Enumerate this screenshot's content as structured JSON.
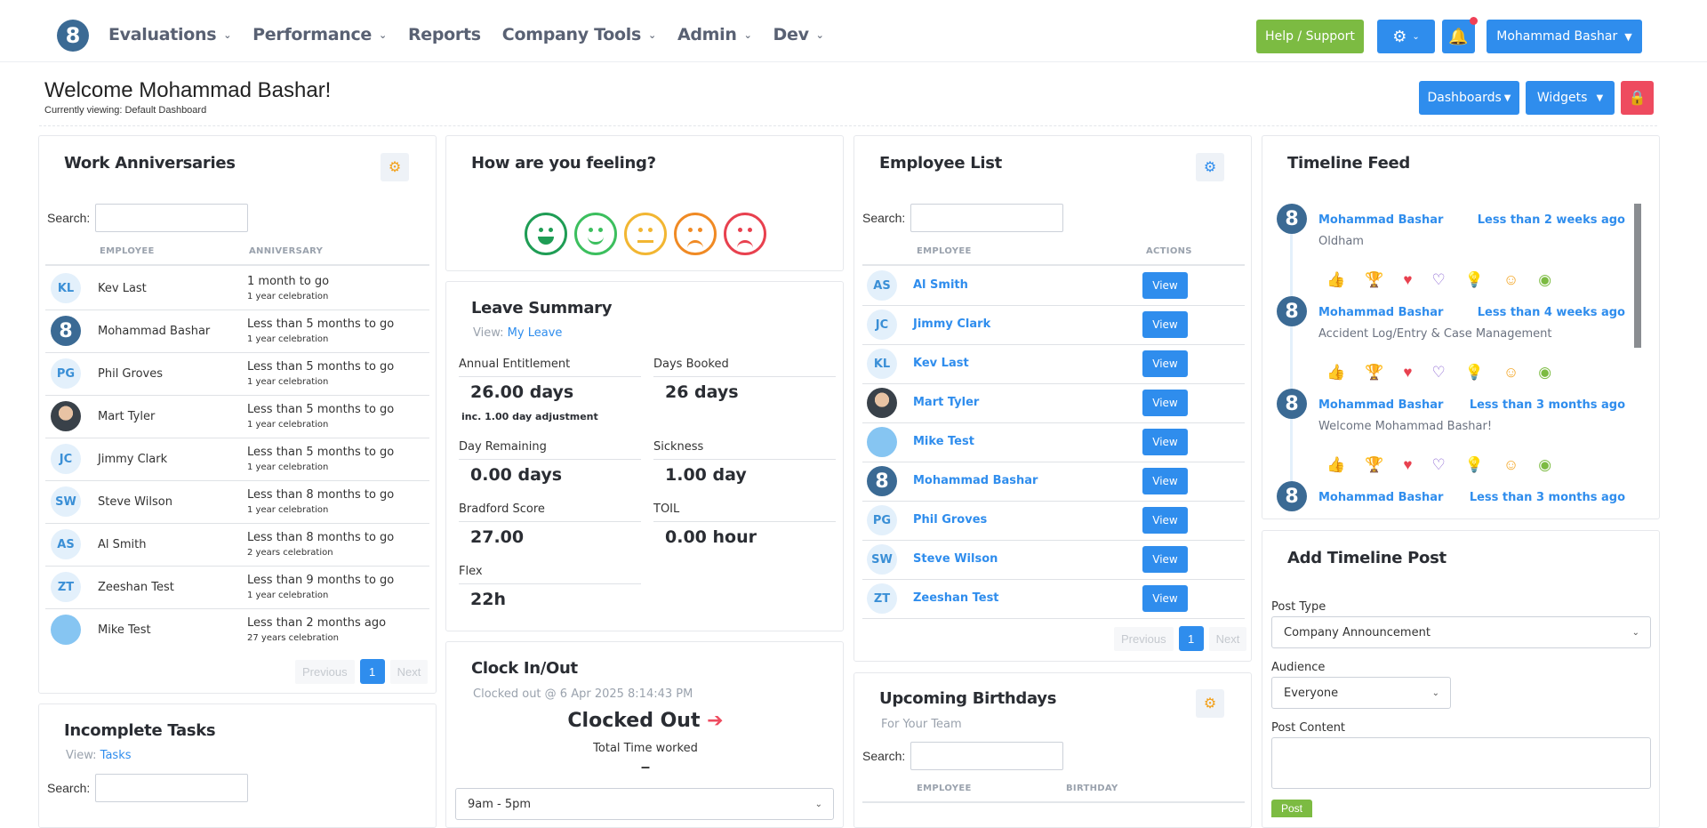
{
  "nav": {
    "logo_text": "8",
    "items": [
      {
        "label": "Evaluations",
        "dropdown": true
      },
      {
        "label": "Performance",
        "dropdown": true
      },
      {
        "label": "Reports",
        "dropdown": false
      },
      {
        "label": "Company Tools",
        "dropdown": true
      },
      {
        "label": "Admin",
        "dropdown": true
      },
      {
        "label": "Dev",
        "dropdown": true
      }
    ],
    "help_label": "Help / Support",
    "user_label": "Mohammad Bashar",
    "colors": {
      "primary": "#2f8ded",
      "help": "#7cbb42",
      "danger": "#ee4b5f",
      "badge": "#ef4056"
    }
  },
  "welcome": {
    "title": "Welcome Mohammad Bashar!",
    "viewing": "Currently viewing: Default Dashboard",
    "dashboards_label": "Dashboards",
    "widgets_label": "Widgets"
  },
  "work_anniversaries": {
    "title": "Work Anniversaries",
    "search_label": "Search:",
    "col_employee": "EMPLOYEE",
    "col_anniversary": "ANNIVERSARY",
    "rows": [
      {
        "initials": "KL",
        "avatar": "initials",
        "name": "Kev Last",
        "anniversary": "1 month to go",
        "celebration": "1 year celebration"
      },
      {
        "initials": "",
        "avatar": "logo",
        "name": "Mohammad Bashar",
        "anniversary": "Less than 5 months to go",
        "celebration": "1 year celebration"
      },
      {
        "initials": "PG",
        "avatar": "initials",
        "name": "Phil Groves",
        "anniversary": "Less than 5 months to go",
        "celebration": "1 year celebration"
      },
      {
        "initials": "",
        "avatar": "photo",
        "name": "Mart Tyler",
        "anniversary": "Less than 5 months to go",
        "celebration": "1 year celebration"
      },
      {
        "initials": "JC",
        "avatar": "initials",
        "name": "Jimmy Clark",
        "anniversary": "Less than 5 months to go",
        "celebration": "1 year celebration"
      },
      {
        "initials": "SW",
        "avatar": "initials",
        "name": "Steve Wilson",
        "anniversary": "Less than 8 months to go",
        "celebration": "1 year celebration"
      },
      {
        "initials": "AS",
        "avatar": "initials",
        "name": "Al Smith",
        "anniversary": "Less than 8 months to go",
        "celebration": "2 years celebration"
      },
      {
        "initials": "ZT",
        "avatar": "initials",
        "name": "Zeeshan Test",
        "anniversary": "Less than 9 months to go",
        "celebration": "1 year celebration"
      },
      {
        "initials": "",
        "avatar": "plain",
        "name": "Mike Test",
        "anniversary": "Less than 2 months ago",
        "celebration": "27 years celebration"
      }
    ],
    "pager": {
      "previous": "Previous",
      "current": "1",
      "next": "Next"
    }
  },
  "feeling": {
    "title": "How are you feeling?",
    "faces": [
      {
        "mood": "very-happy",
        "color": "#1f9d55"
      },
      {
        "mood": "happy",
        "color": "#3cbf5e"
      },
      {
        "mood": "neutral",
        "color": "#f2b632"
      },
      {
        "mood": "sad",
        "color": "#f08a24"
      },
      {
        "mood": "very-sad",
        "color": "#e8414f"
      }
    ]
  },
  "leave_summary": {
    "title": "Leave Summary",
    "view_prefix": "View:",
    "view_link": "My Leave",
    "annual_label": "Annual Entitlement",
    "annual_value": "26.00 days",
    "annual_note": "inc. 1.00 day adjustment",
    "booked_label": "Days Booked",
    "booked_value": "26 days",
    "remaining_label": "Day Remaining",
    "remaining_value": "0.00 days",
    "sickness_label": "Sickness",
    "sickness_value": "1.00 day",
    "bradford_label": "Bradford Score",
    "bradford_value": "27.00",
    "toil_label": "TOIL",
    "toil_value": "0.00 hour",
    "flex_label": "Flex",
    "flex_value": "22h"
  },
  "clock": {
    "title": "Clock In/Out",
    "status_line": "Clocked out @ 6 Apr 2025 8:14:43 PM",
    "state": "Clocked Out",
    "total_label": "Total Time worked",
    "total_value": "–",
    "shift": "9am - 5pm"
  },
  "employee_list": {
    "title": "Employee List",
    "search_label": "Search:",
    "col_employee": "EMPLOYEE",
    "col_actions": "ACTIONS",
    "view_label": "View",
    "rows": [
      {
        "initials": "AS",
        "avatar": "initials",
        "name": "Al Smith"
      },
      {
        "initials": "JC",
        "avatar": "initials",
        "name": "Jimmy Clark"
      },
      {
        "initials": "KL",
        "avatar": "initials",
        "name": "Kev Last"
      },
      {
        "initials": "",
        "avatar": "photo",
        "name": "Mart Tyler"
      },
      {
        "initials": "",
        "avatar": "plain",
        "name": "Mike Test"
      },
      {
        "initials": "",
        "avatar": "logo",
        "name": "Mohammad Bashar"
      },
      {
        "initials": "PG",
        "avatar": "initials",
        "name": "Phil Groves"
      },
      {
        "initials": "SW",
        "avatar": "initials",
        "name": "Steve Wilson"
      },
      {
        "initials": "ZT",
        "avatar": "initials",
        "name": "Zeeshan Test"
      }
    ],
    "pager": {
      "previous": "Previous",
      "current": "1",
      "next": "Next"
    }
  },
  "birthdays": {
    "title": "Upcoming Birthdays",
    "subtitle": "For Your Team",
    "search_label": "Search:",
    "col_employee": "EMPLOYEE",
    "col_birthday": "BIRTHDAY"
  },
  "incomplete_tasks": {
    "title": "Incomplete Tasks",
    "view_prefix": "View:",
    "view_link": "Tasks",
    "search_label": "Search:"
  },
  "timeline": {
    "title": "Timeline Feed",
    "posts": [
      {
        "name": "Mohammad Bashar",
        "time": "Less than 2 weeks ago",
        "text": "Oldham"
      },
      {
        "name": "Mohammad Bashar",
        "time": "Less than 4 weeks ago",
        "text": "Accident Log/Entry & Case Management"
      },
      {
        "name": "Mohammad Bashar",
        "time": "Less than 3 months ago",
        "text": "Welcome Mohammad Bashar!"
      },
      {
        "name": "Mohammad Bashar",
        "time": "Less than 3 months ago",
        "text": ""
      }
    ],
    "reactions": [
      {
        "icon": "thumbs-up-icon",
        "glyph": "👍",
        "color": "#2f8ded"
      },
      {
        "icon": "trophy-icon",
        "glyph": "🏆",
        "color": "#f2b632"
      },
      {
        "icon": "heart-icon",
        "glyph": "♥",
        "color": "#e8414f"
      },
      {
        "icon": "care-icon",
        "glyph": "♡",
        "color": "#8a63d2"
      },
      {
        "icon": "lightbulb-icon",
        "glyph": "💡",
        "color": "#22b5e8"
      },
      {
        "icon": "laugh-icon",
        "glyph": "☺",
        "color": "#f2a019"
      },
      {
        "icon": "eye-icon",
        "glyph": "◉",
        "color": "#7cbb42"
      }
    ]
  },
  "add_post": {
    "title": "Add Timeline Post",
    "post_type_label": "Post Type",
    "post_type_value": "Company Announcement",
    "audience_label": "Audience",
    "audience_value": "Everyone",
    "content_label": "Post Content",
    "post_button": "Post"
  }
}
